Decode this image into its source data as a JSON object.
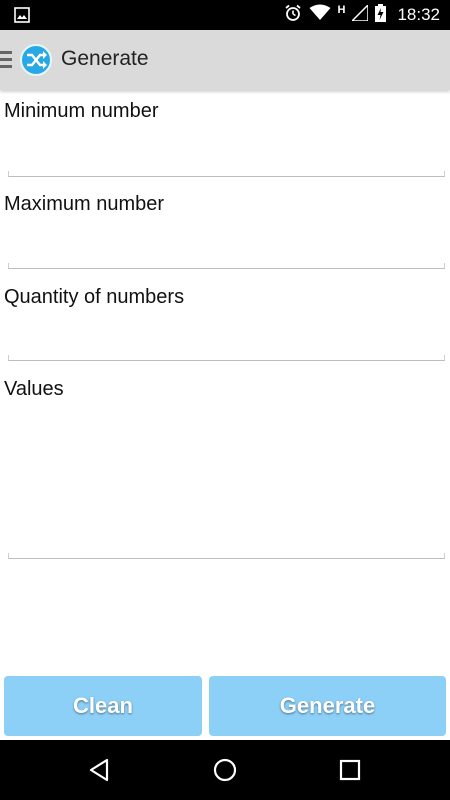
{
  "status_bar": {
    "time": "18:32",
    "network_indicator": "H",
    "icons": [
      "image-icon",
      "alarm-icon",
      "wifi-icon",
      "signal-icon",
      "battery-charging-icon"
    ]
  },
  "action_bar": {
    "title": "Generate",
    "icons": [
      "drawer-icon",
      "shuffle-icon"
    ]
  },
  "form": {
    "min_label": "Minimum number",
    "min_value": "",
    "max_label": "Maximum number",
    "max_value": "",
    "qty_label": "Quantity of numbers",
    "qty_value": "",
    "values_label": "Values",
    "values_value": ""
  },
  "buttons": {
    "clean_label": "Clean",
    "generate_label": "Generate"
  },
  "nav_bar": {
    "icons": [
      "back-icon",
      "home-icon",
      "recents-icon"
    ]
  },
  "colors": {
    "action_bar_bg": "#dadada",
    "button_bg": "#8ccff7",
    "logo_blue": "#29a8e6"
  }
}
